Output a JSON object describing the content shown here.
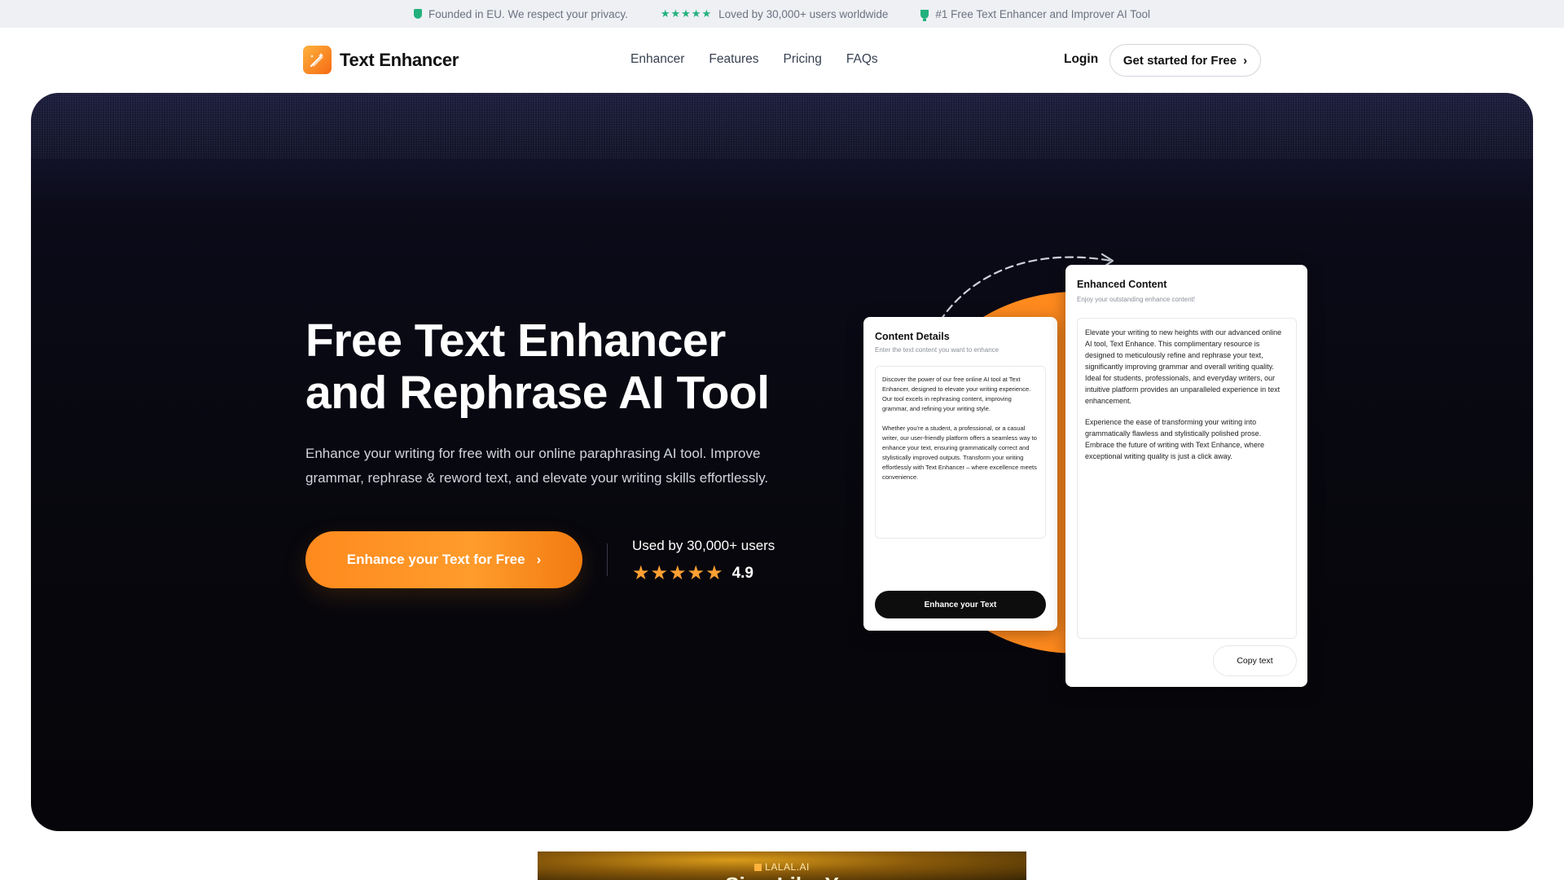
{
  "topbar": {
    "privacy": "Founded in EU. We respect your privacy.",
    "loved": "Loved by 30,000+ users worldwide",
    "rank": "#1 Free Text Enhancer and Improver AI Tool",
    "stars": "★★★★★"
  },
  "nav": {
    "brand": "Text Enhancer",
    "links": [
      "Enhancer",
      "Features",
      "Pricing",
      "FAQs"
    ],
    "login": "Login",
    "cta": "Get started for Free",
    "cta_chevron": "›"
  },
  "hero": {
    "title_line1": "Free Text Enhancer",
    "title_line2": "and Rephrase AI Tool",
    "subtitle": "Enhance your writing for free with our online paraphrasing AI tool. Improve grammar, rephrase & reword text, and elevate your writing skills effortlessly.",
    "cta": "Enhance your Text for Free",
    "cta_chevron": "›",
    "users": "Used by 30,000+ users",
    "stars": "★★★★★",
    "rating": "4.9"
  },
  "input_card": {
    "title": "Content Details",
    "hint": "Enter the text content you want to enhance",
    "para1": "Discover the power of our free online AI tool at Text Enhancer, designed to elevate your writing experience. Our tool excels in rephrasing content, improving grammar, and refining your writing style.",
    "para2": "Whether you're a student, a professional, or a casual writer, our user-friendly platform offers a seamless way to enhance your text, ensuring grammatically correct and stylistically improved outputs. Transform your writing effortlessly with Text Enhancer – where excellence meets convenience.",
    "button": "Enhance your Text"
  },
  "output_card": {
    "title": "Enhanced Content",
    "hint": "Enjoy your outstanding enhance content!",
    "para1": "Elevate your writing to new heights with our advanced online AI tool, Text Enhance. This complimentary resource is designed to meticulously refine and rephrase your text, significantly improving grammar and overall writing quality. Ideal for students, professionals, and everyday writers, our intuitive platform provides an unparalleled experience in text enhancement.",
    "para2": "Experience the ease of transforming your writing into grammatically flawless and stylistically polished prose. Embrace the future of writing with Text Enhance, where exceptional writing quality is just a click away.",
    "button": "Copy text"
  },
  "banner": {
    "brand": "LALAL.AI",
    "headline": "Sing Like Y"
  },
  "colors": {
    "accent": "#ff8a1e",
    "badge_green": "#22b07d",
    "star": "#ffa033",
    "hero_bg": "#07070d"
  },
  "icons": {
    "privacy": "shield-icon",
    "rank": "trophy-icon",
    "logo": "pen-sparkle-icon",
    "arrow": "dashed-curved-arrow-icon"
  }
}
